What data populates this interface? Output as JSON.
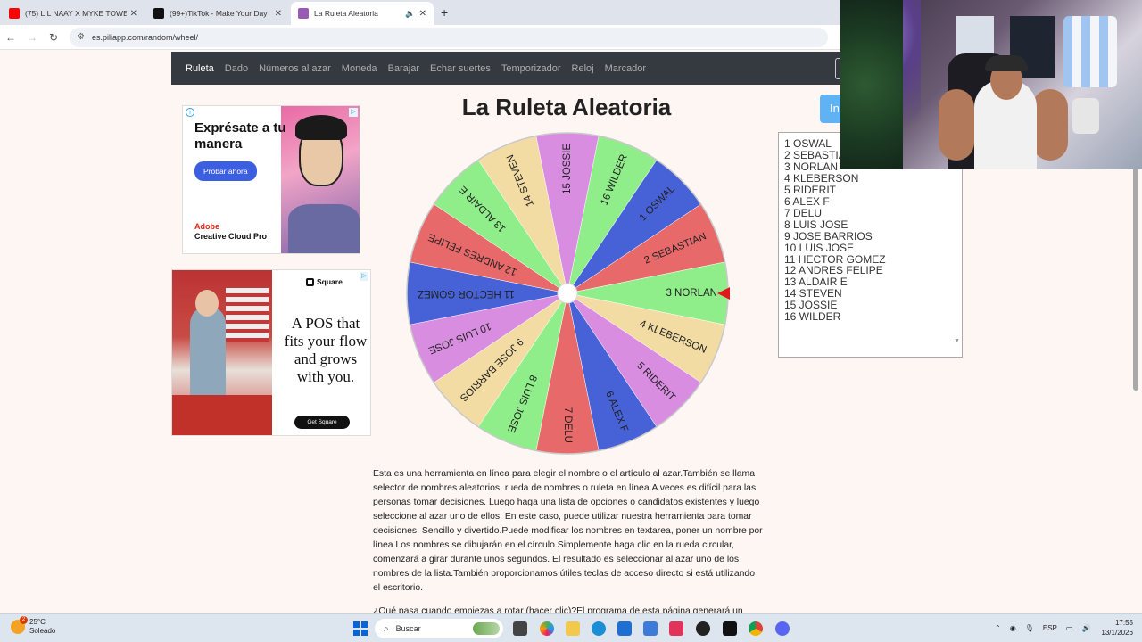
{
  "browser": {
    "tabs": [
      {
        "title": "(75) LIL NAAY X MYKE TOWERS",
        "icon": "youtube-icon",
        "color": "#ff0000",
        "active": false
      },
      {
        "title": "(99+)TikTok - Make Your Day",
        "icon": "tiktok-icon",
        "color": "#111111",
        "active": false
      },
      {
        "title": "La Ruleta Aleatoria",
        "icon": "wheel-favicon",
        "color": "#9b59b6",
        "active": true
      }
    ],
    "url": "es.piliapp.com/random/wheel/"
  },
  "nav": {
    "items": [
      "Ruleta",
      "Dado",
      "Números al azar",
      "Moneda",
      "Barajar",
      "Echar suertes",
      "Temporizador",
      "Reloj",
      "Marcador"
    ],
    "active": "Ruleta"
  },
  "ad1": {
    "headline": "Exprésate a tu manera",
    "cta": "Probar ahora",
    "brand_line1": "Adobe",
    "brand_line2": "Creative Cloud Pro"
  },
  "ad2": {
    "brand": "Square",
    "text": "A POS that fits your flow and grows with you.",
    "cta": "Get Square"
  },
  "main": {
    "title": "La Ruleta Aleatoria",
    "spin_label": "In"
  },
  "wheel": {
    "segments": [
      {
        "label": "1 OSWAL",
        "color": "#4762d6"
      },
      {
        "label": "2 SEBASTIAN",
        "color": "#e8696a"
      },
      {
        "label": "3 NORLAN",
        "color": "#8fee8a"
      },
      {
        "label": "4 KLEBERSON",
        "color": "#f2dca4"
      },
      {
        "label": "5 RIDERIT",
        "color": "#d88de0"
      },
      {
        "label": "6 ALEX F",
        "color": "#4762d6"
      },
      {
        "label": "7 DELU",
        "color": "#e8696a"
      },
      {
        "label": "8 LUIS JOSE",
        "color": "#8fee8a"
      },
      {
        "label": "9 JOSE BARRIOS",
        "color": "#f2dca4"
      },
      {
        "label": "10 LUIS JOSE",
        "color": "#d88de0"
      },
      {
        "label": "11 HECTOR GOMEZ",
        "color": "#4762d6"
      },
      {
        "label": "12 ANDRES FELIPE",
        "color": "#e8696a"
      },
      {
        "label": "13 ALDAIR E",
        "color": "#8fee8a"
      },
      {
        "label": "14 STEVEN",
        "color": "#f2dca4"
      },
      {
        "label": "15 JOSSIE",
        "color": "#d88de0"
      },
      {
        "label": "16 WILDER",
        "color": "#8fee8a"
      }
    ],
    "pointer_color": "#e0191d"
  },
  "names": [
    "1 OSWAL",
    "2 SEBASTIA",
    "3 NORLAN",
    "4 KLEBERSON",
    "5 RIDERIT",
    "6 ALEX F",
    "7 DELU",
    "8 LUIS JOSE",
    "9 JOSE BARRIOS",
    "10 LUIS JOSE",
    "11 HECTOR GOMEZ",
    "12 ANDRES FELIPE",
    "13 ALDAIR E",
    "14 STEVEN",
    "15 JOSSIE",
    "16 WILDER"
  ],
  "description": "Esta es una herramienta en línea para elegir el nombre o el artículo al azar.También se llama selector de nombres aleatorios, rueda de nombres o ruleta en línea.A veces es difícil para las personas tomar decisiones. Luego haga una lista de opciones o candidatos existentes y luego seleccione al azar uno de ellos. En este caso, puede utilizar nuestra herramienta para tomar decisiones. Sencillo y divertido.Puede modificar los nombres en textarea, poner un nombre por línea.Los nombres se dibujarán en el círculo.Simplemente haga clic en la rueda circular, comenzará a girar durante unos segundos. El resultado es seleccionar al azar uno de los nombres de la lista.También proporcionamos útiles teclas de acceso directo si está utilizando el escritorio.",
  "description2": "¿Qué pasa cuando empiezas a rotar (hacer clic)?El programa de esta página generará un",
  "taskbar": {
    "temp": "25°C",
    "weather": "Soleado",
    "weather_badge": "2",
    "search": "Buscar",
    "lang": "ESP",
    "time": "17:55",
    "date": "13/1/2026"
  }
}
